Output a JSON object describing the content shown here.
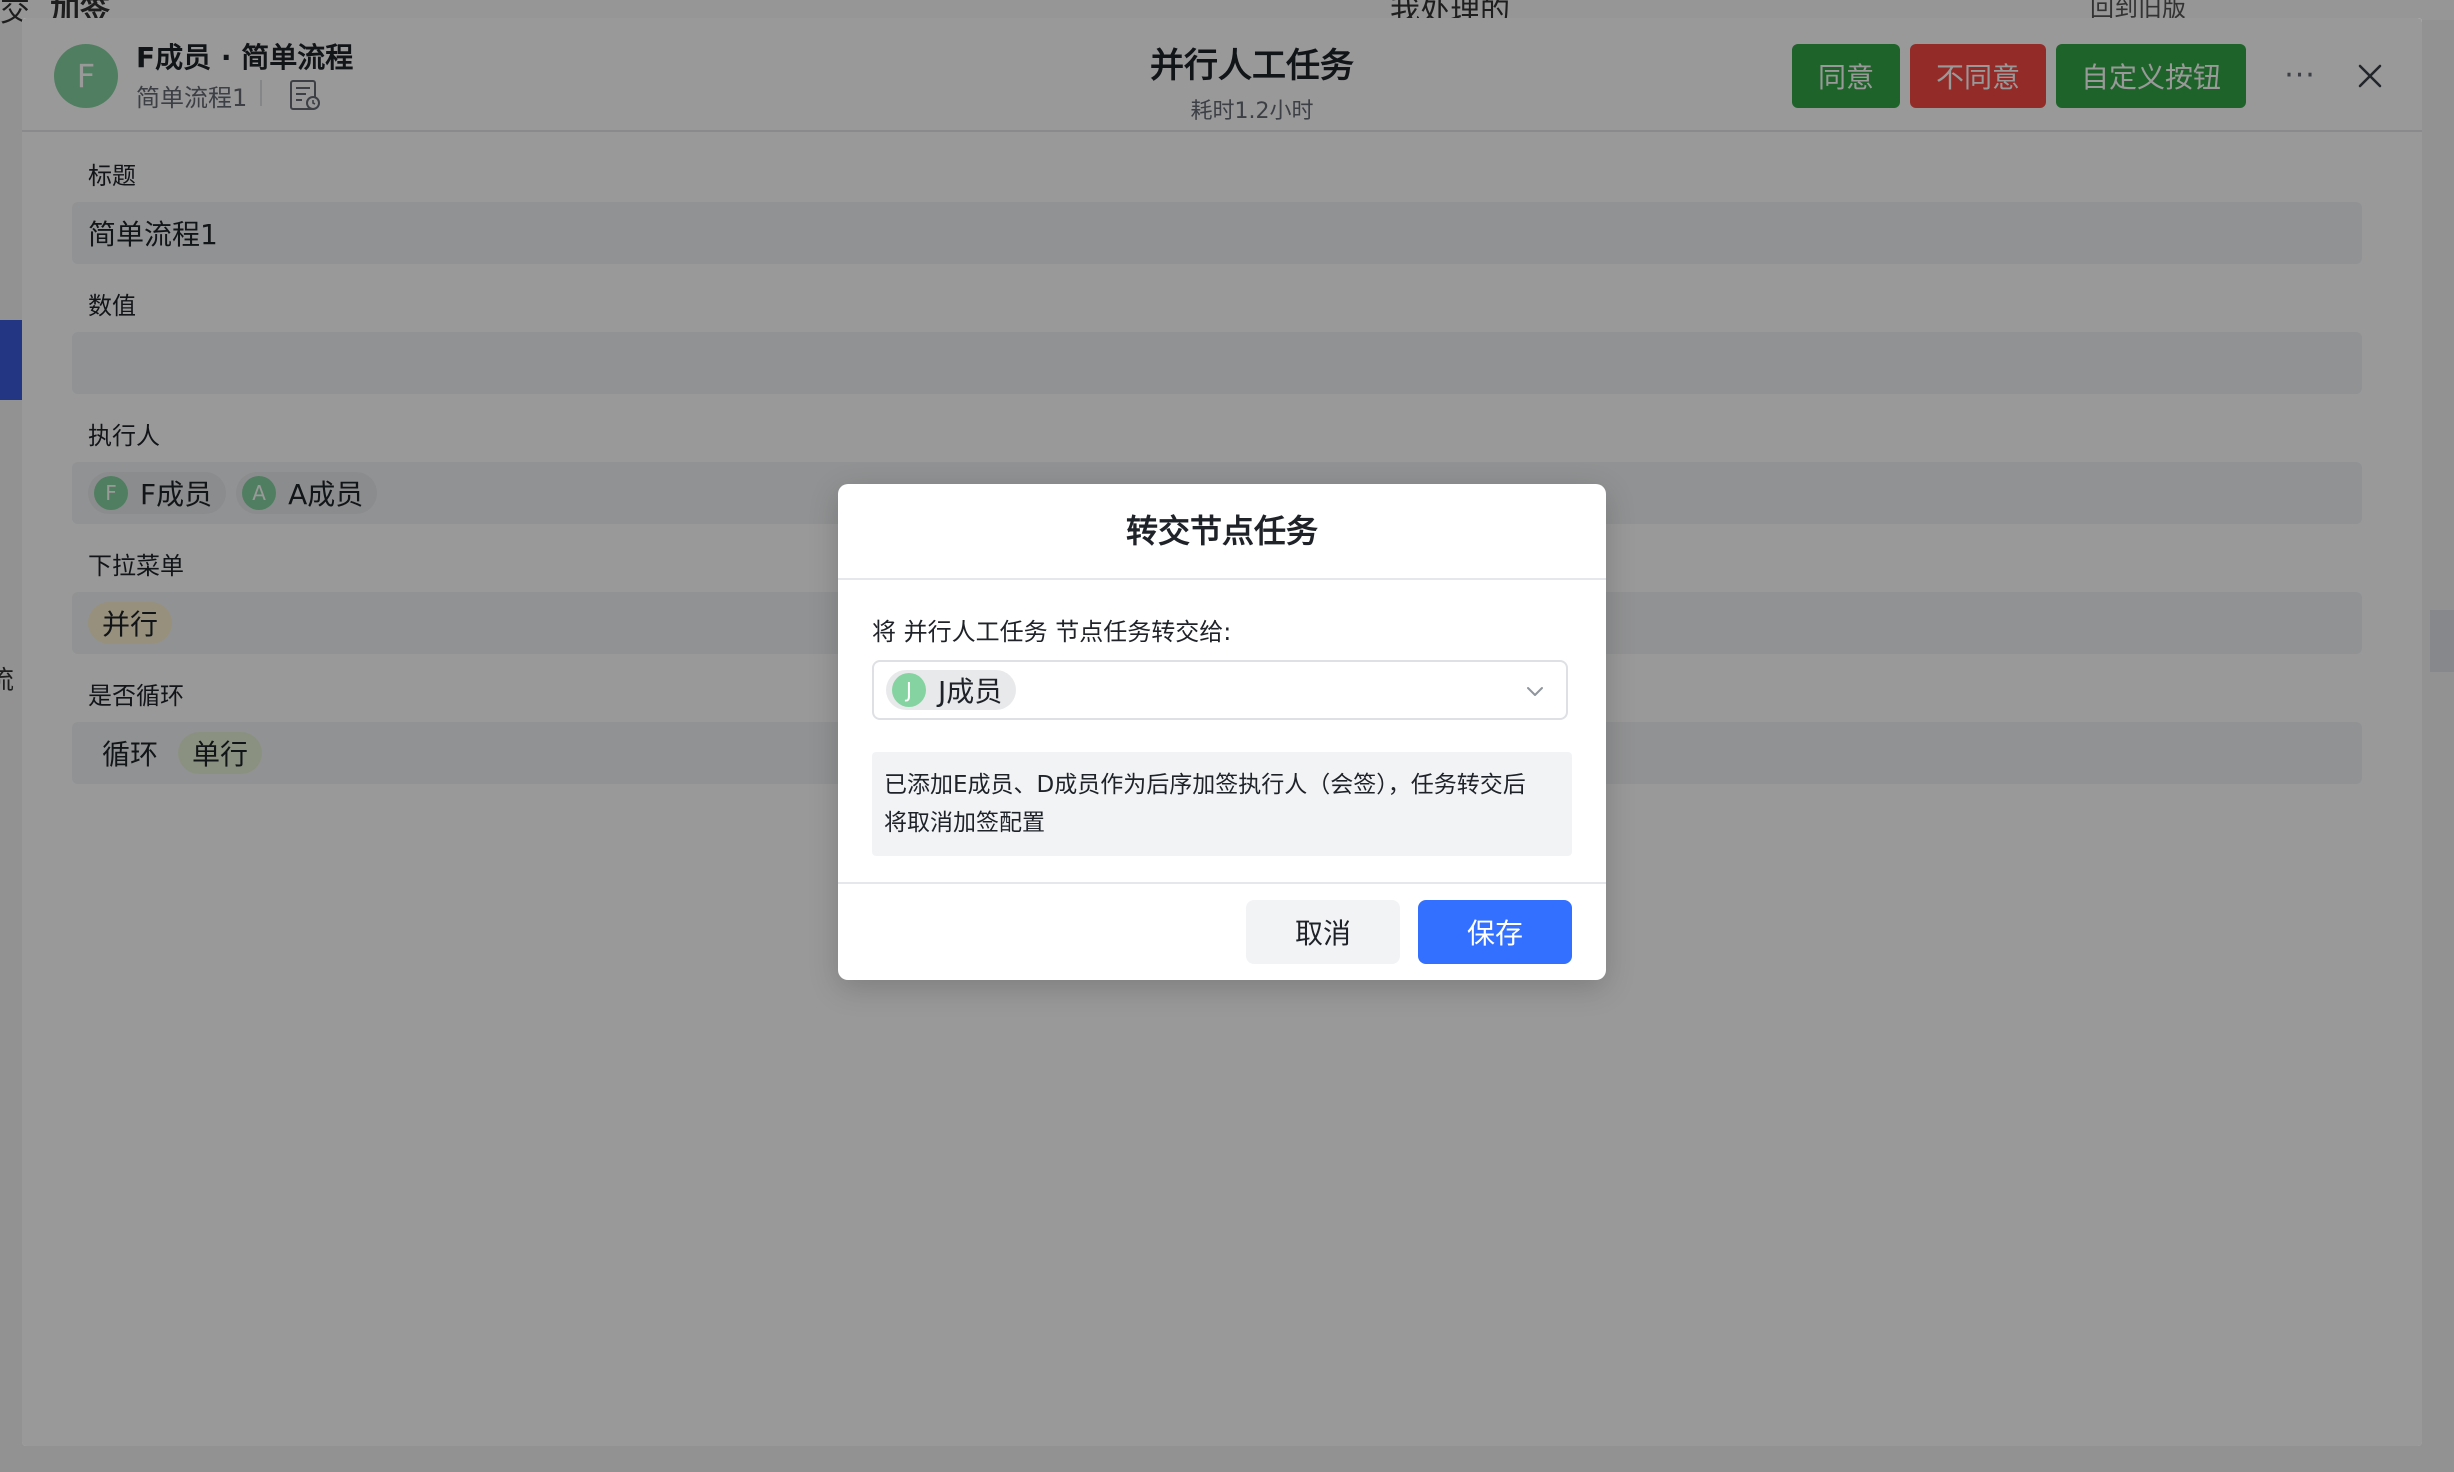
{
  "background": {
    "top_left_partial": "交",
    "top_tab_partial": "加签",
    "top_center_partial": "我处理的",
    "top_right_partial": "回到旧版",
    "left_label_partial": "流"
  },
  "header": {
    "avatar_letter": "F",
    "title": "F成员 · 简单流程",
    "subtitle": "简单流程1",
    "task_name": "并行人工任务",
    "duration": "耗时1.2小时",
    "buttons": {
      "agree": "同意",
      "disagree": "不同意",
      "custom": "自定义按钮"
    },
    "more": "···"
  },
  "form": {
    "title": {
      "label": "标题",
      "value": "简单流程1"
    },
    "number": {
      "label": "数值",
      "value": ""
    },
    "executor": {
      "label": "执行人",
      "members": [
        {
          "letter": "F",
          "name": "F成员"
        },
        {
          "letter": "A",
          "name": "A成员"
        }
      ]
    },
    "dropdown": {
      "label": "下拉菜单",
      "value": "并行"
    },
    "loop": {
      "label": "是否循环",
      "value1": "循环",
      "value2": "单行"
    }
  },
  "dialog": {
    "title": "转交节点任务",
    "prompt": "将 并行人工任务 节点任务转交给:",
    "selected": {
      "letter": "J",
      "name": "J成员"
    },
    "note_line1": "已添加E成员、D成员作为后序加签执行人（会签），任务转交后",
    "note_line2": "将取消加签配置",
    "cancel": "取消",
    "save": "保存"
  },
  "colors": {
    "agree": "#32a645",
    "disagree": "#f54a45",
    "primary": "#3370ff",
    "avatar": "#86d3a2"
  }
}
